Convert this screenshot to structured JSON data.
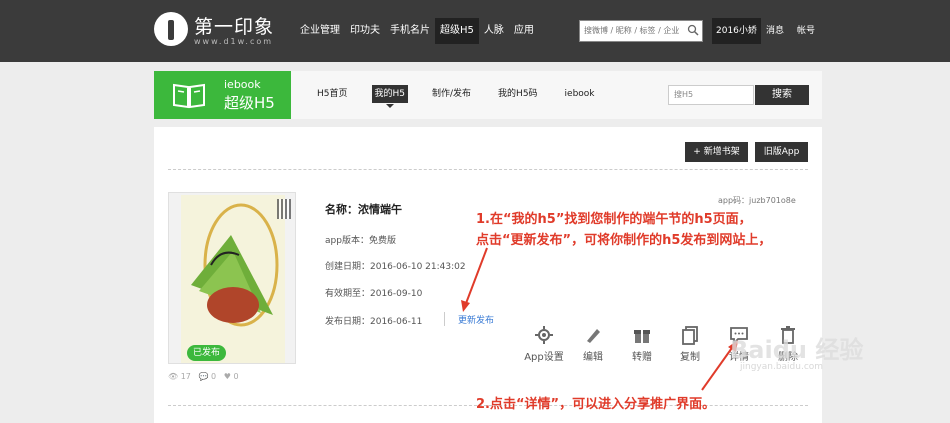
{
  "header": {
    "logo_text": "第一印象",
    "logo_sub": "www.d1w.com",
    "nav": [
      "企业管理",
      "印功夫",
      "手机名片",
      "超级H5",
      "人脉",
      "应用"
    ],
    "active_nav": "超级H5",
    "search_placeholder": "搜微博 / 昵称 / 标签 / 企业",
    "user": "2016小娇",
    "messages": "消息",
    "account": "帐号"
  },
  "subheader": {
    "brand_small": "iebook",
    "brand_big": "超级H5",
    "nav": [
      "H5首页",
      "我的H5",
      "制作/发布",
      "我的H5码",
      "iebook"
    ],
    "active": "我的H5",
    "search_placeholder": "搜H5",
    "search_button": "搜索"
  },
  "toolbar": {
    "new_shelf": "+ 新增书架",
    "old_app": "旧版App"
  },
  "item": {
    "app_code": "app码：juzb701o8e",
    "name": "名称：浓情端午",
    "version": "app版本：免费版",
    "created": "创建日期：2016-06-10 21:43:02",
    "valid_until": "有效期至：2016-09-10",
    "published": "发布日期：2016-06-11",
    "update_link": "更新发布",
    "status_badge": "已发布",
    "stats": {
      "views": "17",
      "comments": "0",
      "likes": "0"
    },
    "actions": [
      "App设置",
      "编辑",
      "转赠",
      "复制",
      "详情",
      "删除"
    ]
  },
  "annotations": {
    "line1": "1.在“我的h5”找到您制作的端午节的h5页面，",
    "line2": "点击“更新发布”，可将你制作的h5发布到网站上，",
    "line3": "2.点击“详情”，可以进入分享推广界面。"
  },
  "watermark": {
    "main": "Baidu 经验",
    "sub": "jingyan.baidu.com"
  },
  "colors": {
    "brand_green": "#3cb83c",
    "topbar": "#3b3b3b",
    "annotation_red": "#e03b2a",
    "link_blue": "#3a7bd5"
  }
}
